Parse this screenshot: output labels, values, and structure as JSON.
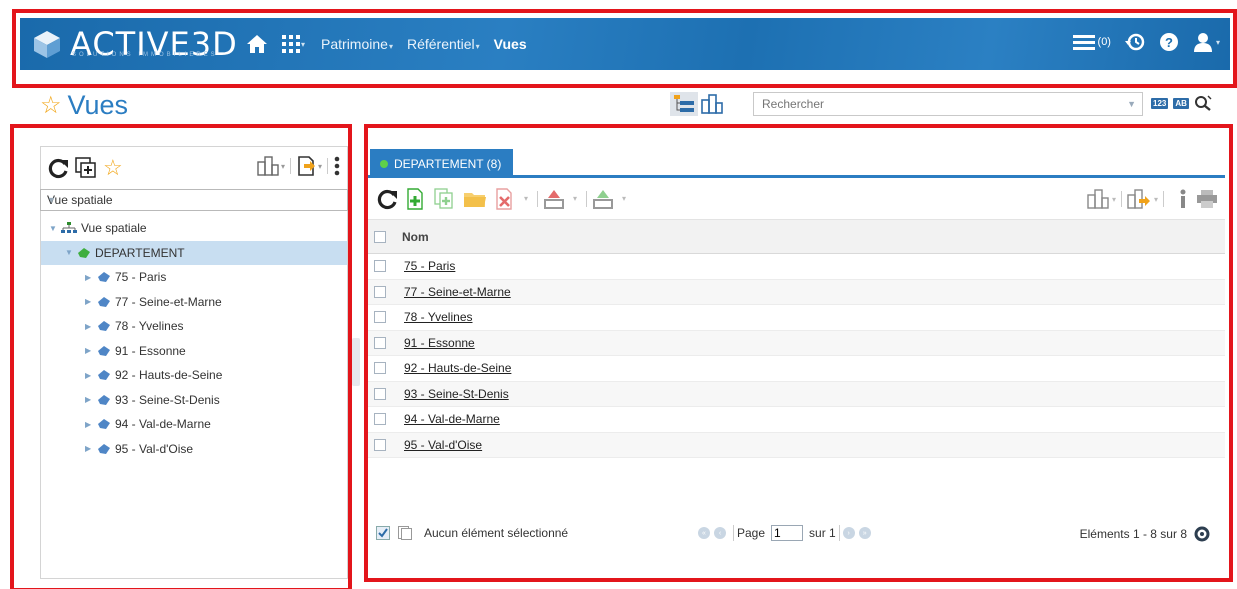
{
  "header": {
    "logo_text": "ACTIVE3D",
    "logo_subtitle": "SOLUTIONS IMMOBILIERES",
    "nav": [
      {
        "label": "Patrimoine"
      },
      {
        "label": "Référentiel"
      },
      {
        "label": "Vues"
      }
    ],
    "notifications_count": "(0)"
  },
  "page": {
    "title": "Vues"
  },
  "search": {
    "placeholder": "Rechercher",
    "tag_123": "123",
    "tag_ab": "AB"
  },
  "left": {
    "combo_value": "Vue spatiale",
    "tree": {
      "root": "Vue spatiale",
      "group": "DEPARTEMENT",
      "items": [
        "75 - Paris",
        "77 - Seine-et-Marne",
        "78 - Yvelines",
        "91 - Essonne",
        "92 - Hauts-de-Seine",
        "93 - Seine-St-Denis",
        "94 - Val-de-Marne",
        "95 - Val-d'Oise"
      ]
    }
  },
  "right": {
    "tab_label": "DEPARTEMENT (8)",
    "column_header": "Nom",
    "rows": [
      "75 - Paris",
      "77 - Seine-et-Marne",
      "78 - Yvelines",
      "91 - Essonne",
      "92 - Hauts-de-Seine",
      "93 - Seine-St-Denis",
      "94 - Val-de-Marne",
      "95 - Val-d'Oise"
    ],
    "pager": {
      "selection_status": "Aucun élément sélectionné",
      "page_label": "Page",
      "page_value": "1",
      "of_label": "sur 1",
      "count_label": "Eléments 1 - 8 sur 8"
    }
  },
  "colors": {
    "topbar": "#1c6fb0",
    "accent": "#2b7dc2",
    "highlight_box": "#e3151b",
    "star": "#f2a81d",
    "status_green": "#5ed04b"
  }
}
